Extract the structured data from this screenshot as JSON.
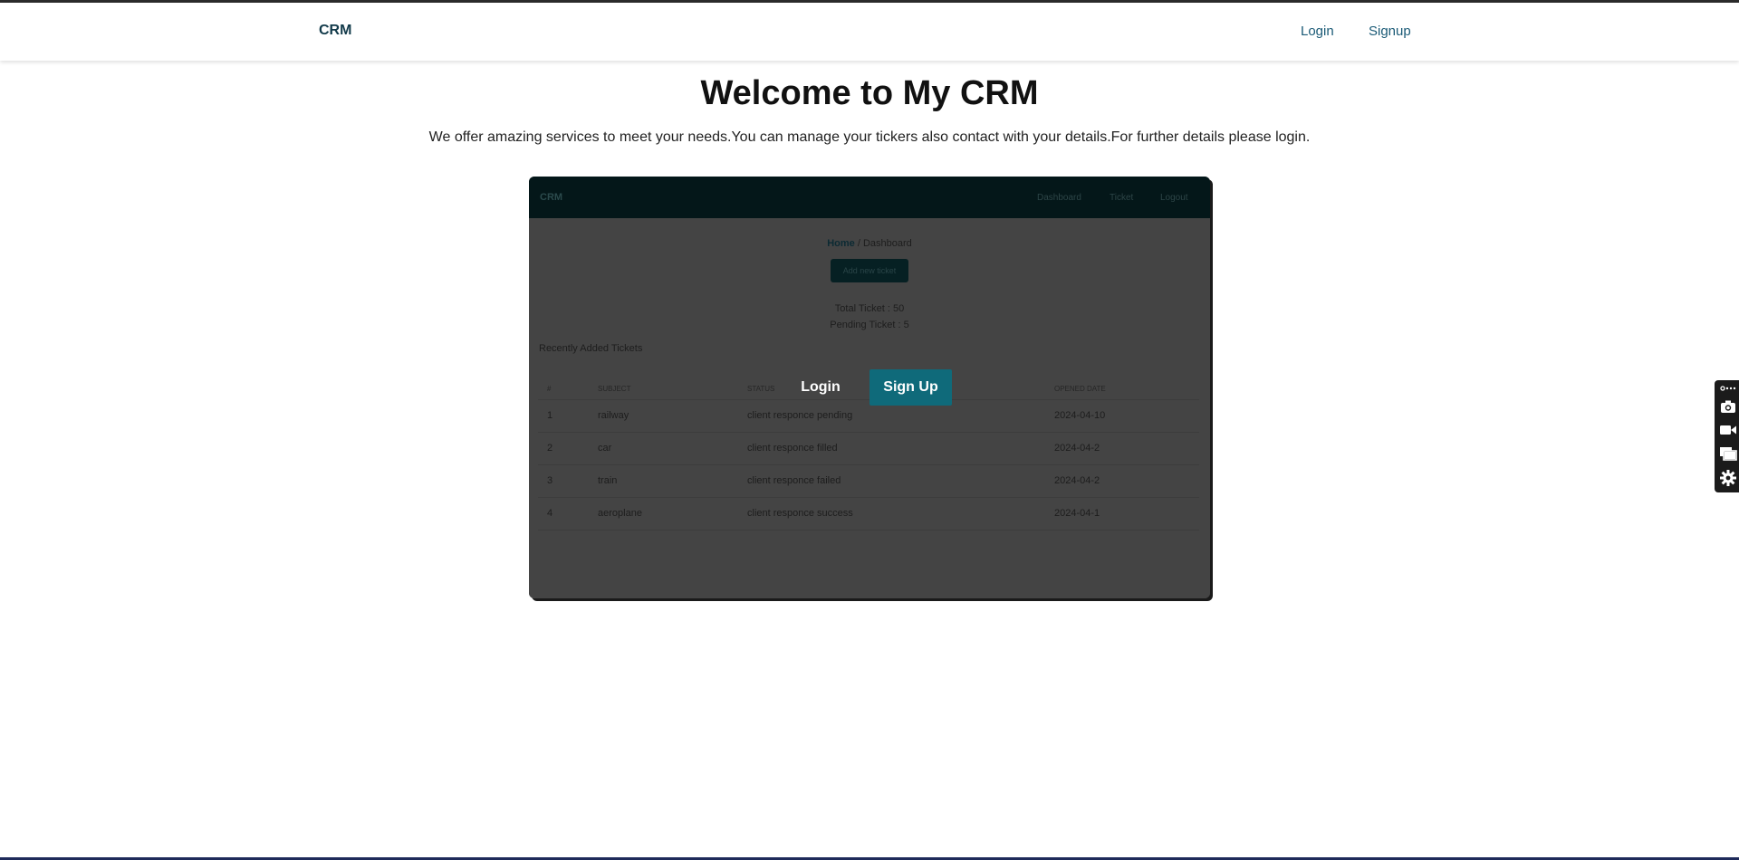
{
  "navbar": {
    "brand": "CRM",
    "login": "Login",
    "signup": "Signup"
  },
  "hero": {
    "title": "Welcome to My CRM",
    "subtitle": "We offer amazing services to meet your needs.You can manage your tickers also contact with your details.For further details please login."
  },
  "preview": {
    "nav": {
      "brand": "CRM",
      "links": [
        "Dashboard",
        "Ticket",
        "Logout"
      ]
    },
    "breadcrumb": {
      "home": "Home",
      "separator": " / ",
      "current": "Dashboard"
    },
    "add_button": "Add new ticket",
    "total_ticket": "Total Ticket : 50",
    "pending_ticket": "Pending Ticket : 5",
    "recent_title": "Recently Added Tickets",
    "table": {
      "headers": [
        "#",
        "Subject",
        "Status",
        "Opened Date"
      ],
      "rows": [
        [
          "1",
          "railway",
          "client responce pending",
          "2024-04-10"
        ],
        [
          "2",
          "car",
          "client responce filled",
          "2024-04-2"
        ],
        [
          "3",
          "train",
          "client responce failed",
          "2024-04-2"
        ],
        [
          "4",
          "aeroplane",
          "client responce success",
          "2024-04-1"
        ]
      ]
    }
  },
  "overlay": {
    "login": "Login",
    "signup": "Sign Up"
  },
  "colors": {
    "accent": "#0f6a7a",
    "brand_text": "#123a4a",
    "link": "#1a5a76"
  },
  "side_widget": {
    "icons": [
      "link-icon",
      "camera-icon",
      "video-icon",
      "windows-icon",
      "gear-icon"
    ]
  }
}
